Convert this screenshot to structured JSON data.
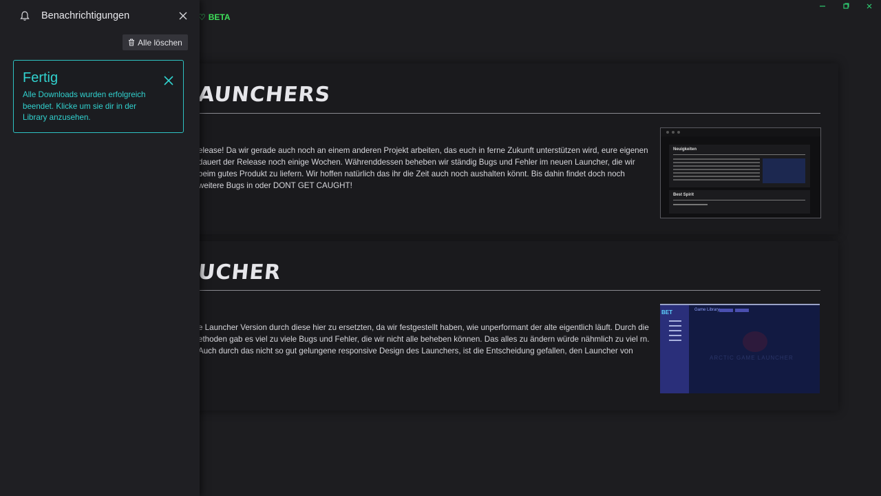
{
  "window": {
    "minimize_icon": "minimize-icon",
    "maximize_icon": "maximize-icon",
    "close_icon": "close-icon",
    "accent_color": "#2ecc71"
  },
  "header": {
    "badge": "BETA",
    "heart_icon": "heart-icon",
    "badge_color": "#3ee05a"
  },
  "cards": [
    {
      "title": "AUNCHERS",
      "text": "elease! Da wir gerade auch noch an einem anderen Projekt arbeiten, das euch in ferne Zukunft unterstützen wird, eure eigenen dauert der Release noch einige Wochen. Währenddessen beheben wir ständig Bugs und Fehler im neuen Launcher, die wir beim gutes Produkt zu liefern. Wir hoffen natürlich das ihr die Zeit auch noch aushalten könnt. Bis dahin findet doch noch weitere Bugs in oder DONT GET CAUGHT!",
      "thumb": {
        "heading": "Neuigkeiten",
        "heading2": "Best Spirit"
      }
    },
    {
      "title": "UCHER",
      "text": "e Launcher Version durch diese hier zu ersetzten, da wir festgestellt haben, wie unperformant der alte eigentlich läuft. Durch die ethoden gab es viel zu viele Bugs und Fehler, die wir nicht alle beheben können. Das alles zu ändern würde nähmlich zu viel rn. Auch durch das nicht so gut gelungene responsive Design des Launchers, ist die Entscheidung gefallen, den Launcher von",
      "thumb": {
        "logo": "BET",
        "title": "Game Library",
        "watermark": "ARCTIC GAME LAUNCHER"
      }
    }
  ],
  "notifications": {
    "title": "Benachrichtigungen",
    "bell_icon": "bell-icon",
    "close_icon": "close-icon",
    "clear_all_label": "Alle löschen",
    "trash_icon": "trash-icon",
    "items": [
      {
        "title": "Fertig",
        "message": "Alle Downloads wurden erfolgreich beendet. Klicke um sie dir in der Library anzusehen.",
        "close_icon": "close-icon",
        "accent_color": "#31d2cf"
      }
    ]
  }
}
